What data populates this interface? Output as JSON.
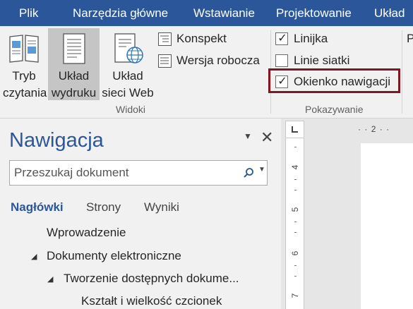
{
  "menubar": {
    "tabs": [
      "Plik",
      "Narzędzia główne",
      "Wstawianie",
      "Projektowanie",
      "Układ"
    ]
  },
  "ribbon": {
    "views": {
      "reading_mode": [
        "Tryb",
        "czytania"
      ],
      "print_layout": [
        "Układ",
        "wydruku"
      ],
      "web_layout": [
        "Układ",
        "sieci Web"
      ],
      "outline": "Konspekt",
      "draft": "Wersja robocza",
      "group_label": "Widoki"
    },
    "show": {
      "ruler": "Linijka",
      "ruler_checked": true,
      "gridlines": "Linie siatki",
      "gridlines_checked": false,
      "nav_pane": "Okienko nawigacji",
      "nav_pane_checked": true,
      "group_label": "Pokazywanie"
    },
    "partial_next": "P"
  },
  "navigation": {
    "title": "Nawigacja",
    "search_placeholder": "Przeszukaj dokument",
    "tabs": [
      "Nagłówki",
      "Strony",
      "Wyniki"
    ],
    "active_tab": "Nagłówki",
    "headings": [
      "Wprowadzenie",
      "Dokumenty elektroniczne",
      "Tworzenie dostępnych dokume...",
      "Kształt i wielkość czcionek"
    ]
  },
  "ruler": {
    "horizontal_label": "2",
    "vertical_numbers": [
      "4",
      "5",
      "6",
      "7"
    ]
  },
  "colors": {
    "accent": "#2b579a",
    "highlight_border": "#7a1a24"
  }
}
